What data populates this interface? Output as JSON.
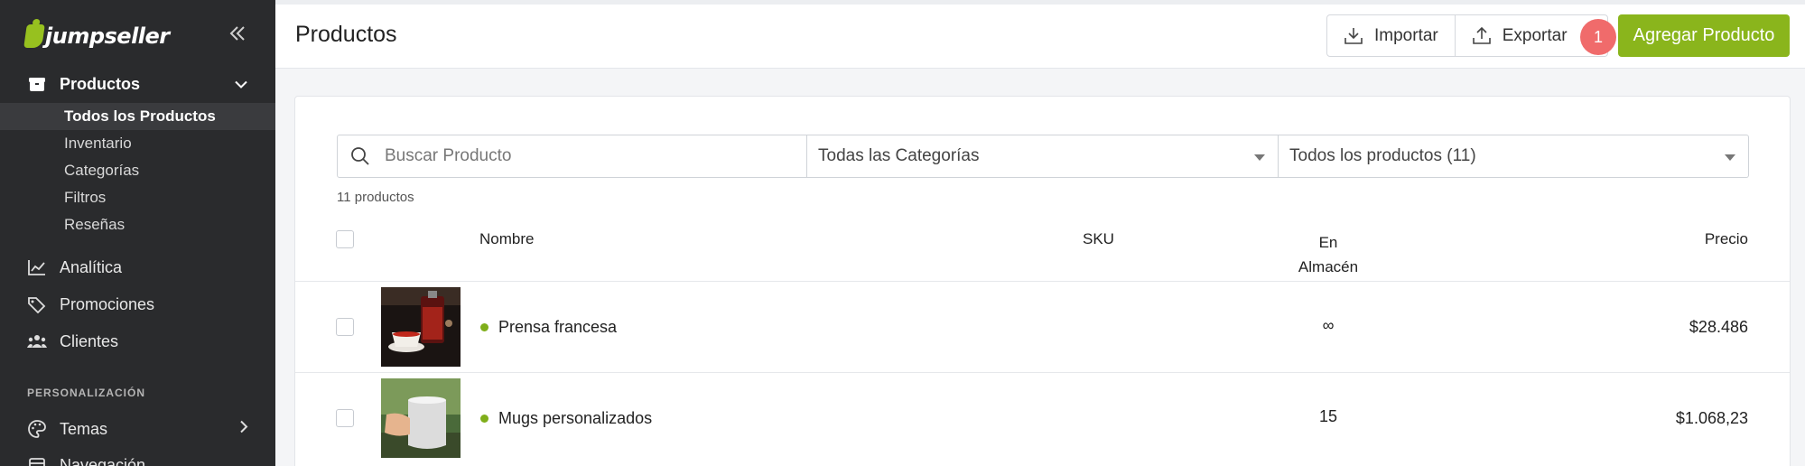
{
  "brand": {
    "name": "jumpseller",
    "accent": "#8ab51c",
    "sidebar_bg": "#2a2b2d"
  },
  "sidebar": {
    "collapse_icon": "double-chevron-left-icon",
    "products": {
      "label": "Productos",
      "icon": "box-icon"
    },
    "sub_items": [
      {
        "label": "Todos los Productos",
        "active": true
      },
      {
        "label": "Inventario"
      },
      {
        "label": "Categorías"
      },
      {
        "label": "Filtros"
      },
      {
        "label": "Reseñas"
      }
    ],
    "analytics": {
      "label": "Analítica",
      "icon": "chart-line-icon"
    },
    "promotions": {
      "label": "Promociones",
      "icon": "tag-icon"
    },
    "customers": {
      "label": "Clientes",
      "icon": "users-icon"
    },
    "section_label": "PERSONALIZACIÓN",
    "themes": {
      "label": "Temas",
      "icon": "palette-icon"
    },
    "navigation": {
      "label": "Navegación",
      "icon": "layout-icon"
    }
  },
  "header": {
    "title": "Productos",
    "import_label": "Importar",
    "export_label": "Exportar",
    "badge": "1",
    "add_label": "Agregar Producto",
    "badge_color": "#f06b6b"
  },
  "filters": {
    "search_placeholder": "Buscar Producto",
    "category_selected": "Todas las Categorías",
    "status_selected": "Todos los productos (11)"
  },
  "count_label": "11 productos",
  "table": {
    "headers": {
      "name": "Nombre",
      "sku": "SKU",
      "stock_line1": "En",
      "stock_line2": "Almacén",
      "price": "Precio"
    },
    "rows": [
      {
        "name": "Prensa francesa",
        "sku": "",
        "stock": "∞",
        "price": "$28.486",
        "status_color": "#7fae1a"
      },
      {
        "name": "Mugs personalizados",
        "sku": "",
        "stock": "15",
        "price": "$1.068,23",
        "status_color": "#7fae1a"
      }
    ]
  }
}
